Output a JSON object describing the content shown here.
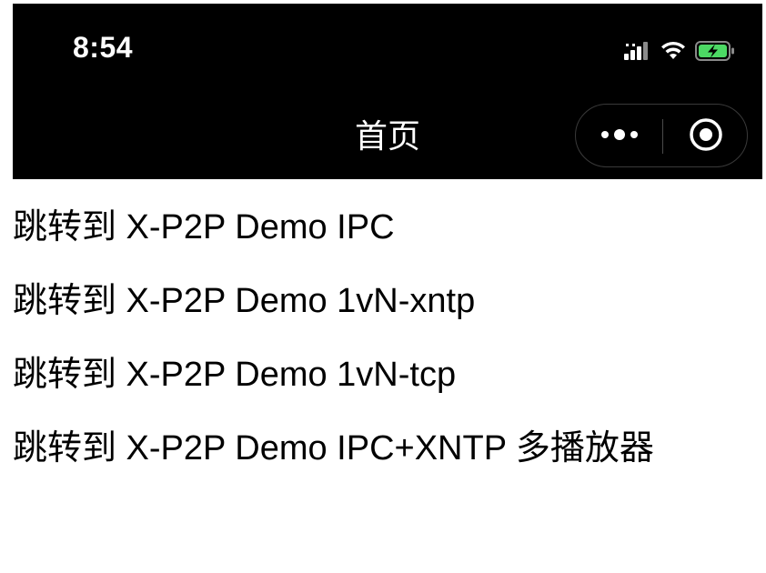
{
  "status_bar": {
    "time": "8:54",
    "icons": [
      "signal-icon",
      "wifi-icon",
      "battery-charging-icon"
    ],
    "battery_color": "#4cd964"
  },
  "nav_bar": {
    "title": "首页",
    "capsule": {
      "more_icon": "more-dots-icon",
      "close_icon": "target-circle-icon"
    }
  },
  "links": [
    {
      "label": "跳转到 X-P2P Demo IPC"
    },
    {
      "label": "跳转到 X-P2P Demo 1vN-xntp"
    },
    {
      "label": "跳转到 X-P2P Demo 1vN-tcp"
    },
    {
      "label": "跳转到 X-P2P Demo IPC+XNTP 多播放器"
    }
  ]
}
